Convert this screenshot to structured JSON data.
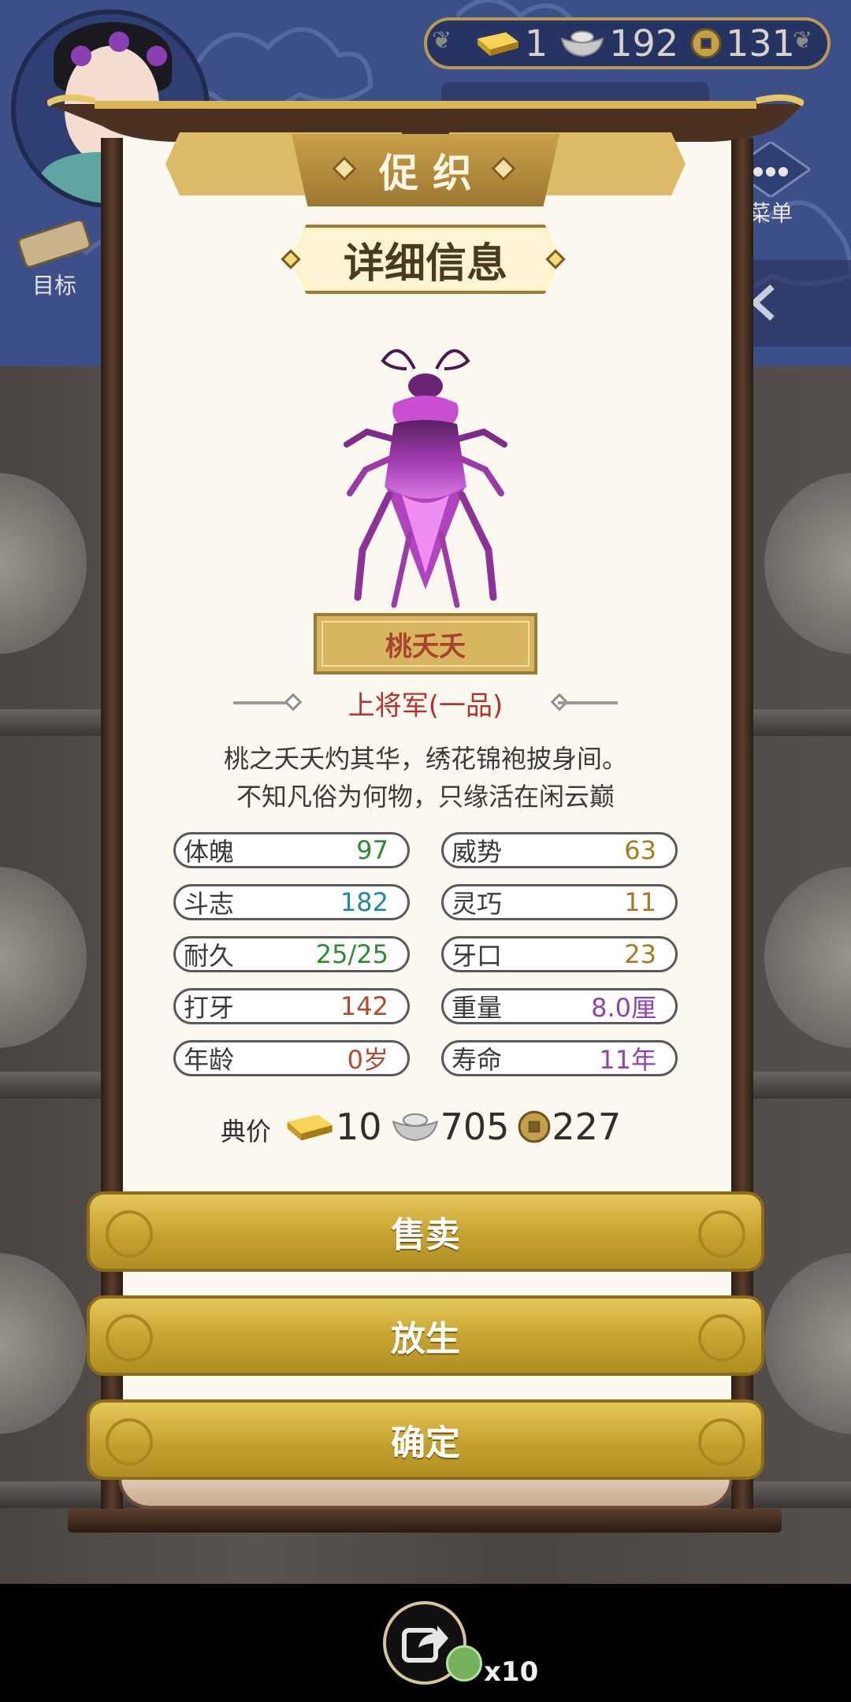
{
  "hud": {
    "currency": [
      {
        "icon": "gold-bar-icon",
        "value": "1"
      },
      {
        "icon": "silver-ingot-icon",
        "value": "192"
      },
      {
        "icon": "copper-coin-icon",
        "value": "131"
      }
    ],
    "menu_label": "菜单",
    "goal_label": "目标"
  },
  "modal": {
    "title": "促织",
    "subtitle": "详细信息",
    "cricket_name": "桃夭夭",
    "rank": "上将军(一品)",
    "description": [
      "桃之夭夭灼其华，绣花锦袍披身间。",
      "不知凡俗为何物，只缘活在闲云巅"
    ],
    "stats": [
      {
        "label": "体魄",
        "value": "97",
        "color": "#2f8c2f"
      },
      {
        "label": "威势",
        "value": "63",
        "color": "#a87a1d"
      },
      {
        "label": "斗志",
        "value": "182",
        "color": "#1f8aa0"
      },
      {
        "label": "灵巧",
        "value": "11",
        "color": "#a87a1d"
      },
      {
        "label": "耐久",
        "value_main": "25",
        "value_rest": "/25",
        "color": "#2f8c2f"
      },
      {
        "label": "牙口",
        "value": "23",
        "color": "#a87a1d"
      },
      {
        "label": "打牙",
        "value": "142",
        "color": "#b34a2c"
      },
      {
        "label": "重量",
        "value": "8.0厘",
        "color": "#8e44ad"
      },
      {
        "label": "年龄",
        "value": "0岁",
        "color": "#b34a2c"
      },
      {
        "label": "寿命",
        "value": "11年",
        "color": "#8e44ad"
      }
    ],
    "price": {
      "label": "典价",
      "gold": "10",
      "silver": "705",
      "copper": "227"
    },
    "buttons": {
      "sell": "售卖",
      "release": "放生",
      "confirm": "确定"
    }
  },
  "bottom": {
    "share_count": "x10"
  },
  "colors": {
    "gold": "#c5a22f",
    "paper": "#fbf8ef",
    "sky": "#3c4f88",
    "rank_red": "#b3322f"
  }
}
